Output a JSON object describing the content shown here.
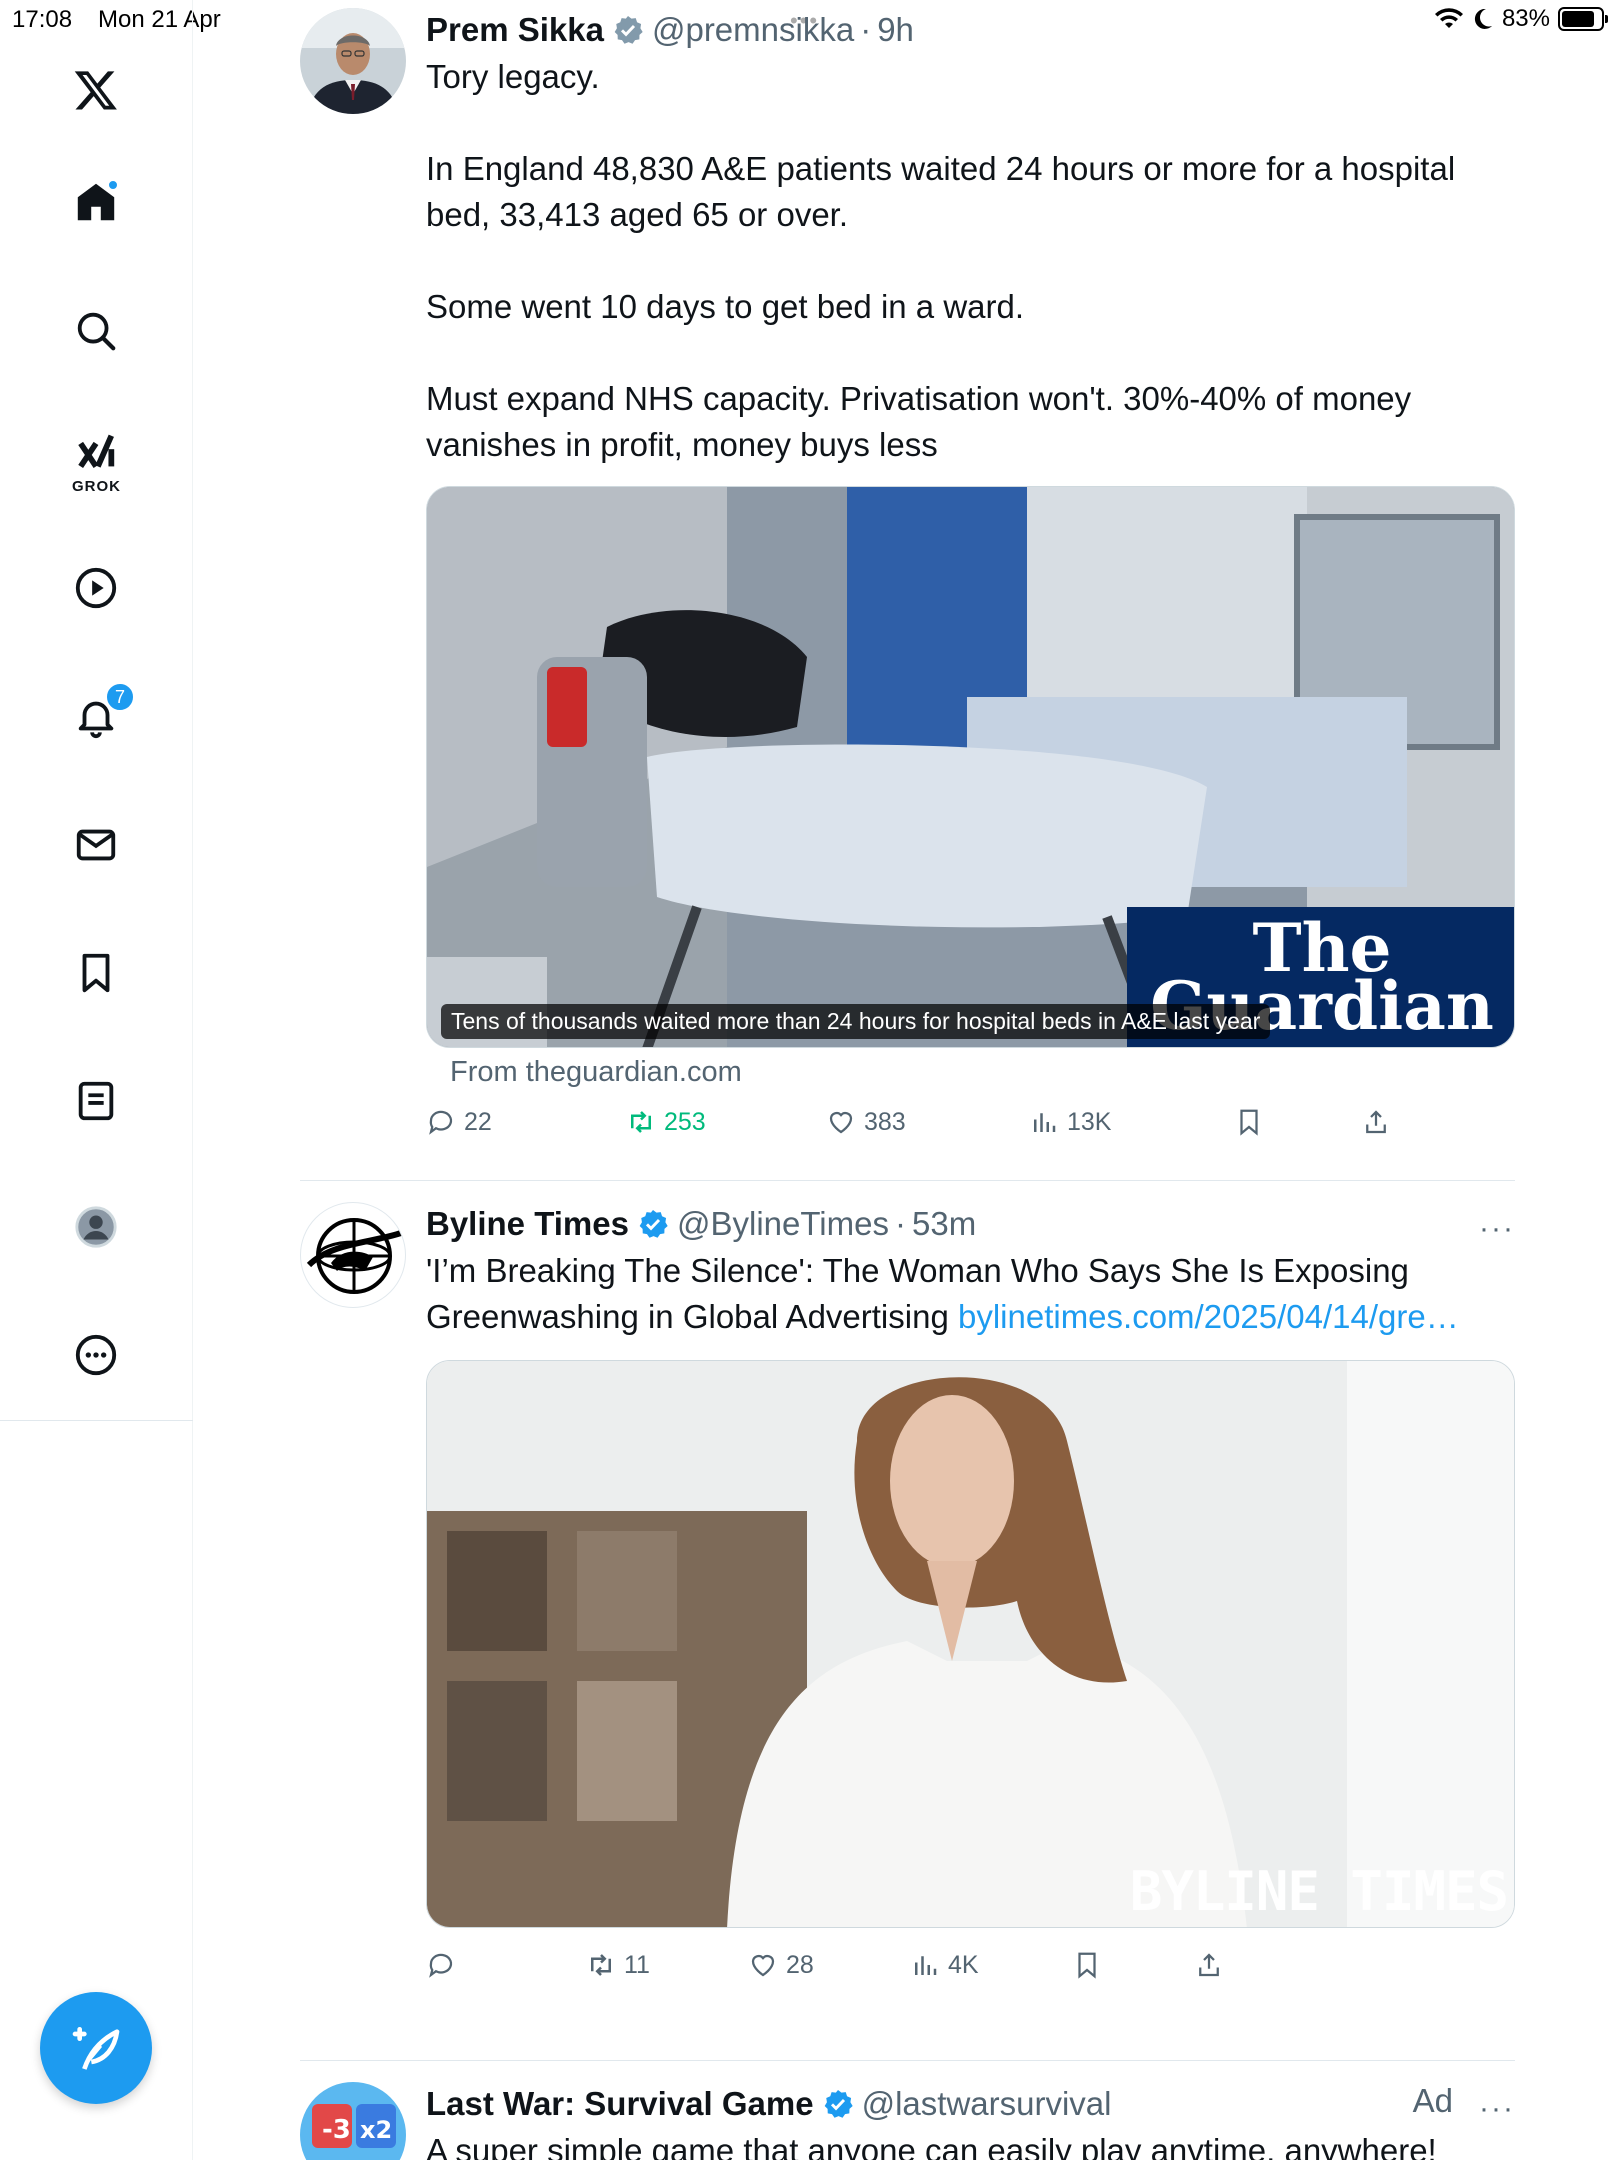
{
  "status": {
    "time": "17:08",
    "date": "Mon 21 Apr",
    "battery": "83%",
    "battery_level": 0.83
  },
  "sidebar": {
    "grok_label": "GROK",
    "notifications_count": "7"
  },
  "tweets": [
    {
      "name": "Prem Sikka",
      "handle": "@premnsikka",
      "sep": "·",
      "time": "9h",
      "text": "Tory legacy.\n\nIn England 48,830 A&E patients waited 24 hours or more for a hospital bed, 33,413 aged 65 or over.\n\nSome went 10 days to get bed in a ward.\n\nMust expand NHS capacity. Privatisation won't. 30%-40% of money vanishes in profit, money buys less",
      "media_caption": "Tens of thousands waited more than 24 hours for hospital beds in A&E last year",
      "media_logo_line1": "The",
      "media_logo_line2": "Guardian",
      "source": "From theguardian.com",
      "replies": "22",
      "retweets": "253",
      "likes": "383",
      "views": "13K"
    },
    {
      "name": "Byline Times",
      "handle": "@BylineTimes",
      "sep": "·",
      "time": "53m",
      "more": "···",
      "text": "'I’m Breaking The Silence': The Woman Who Says She Is Exposing Greenwashing in Global Advertising ",
      "link": "bylinetimes.com/2025/04/14/gre…",
      "media_watermark": "BYLINE TIMES",
      "replies": "",
      "retweets": "11",
      "likes": "28",
      "views": "4K"
    },
    {
      "name": "Last War: Survival Game",
      "handle": "@lastwarsurvival",
      "ad": "Ad",
      "more": "···",
      "text": "A super simple game that anyone can easily play anytime, anywhere!"
    }
  ],
  "colors": {
    "accent": "#1d9bf0",
    "retweet": "#00ba7c",
    "muted": "#536471",
    "guardian": "#052962"
  }
}
